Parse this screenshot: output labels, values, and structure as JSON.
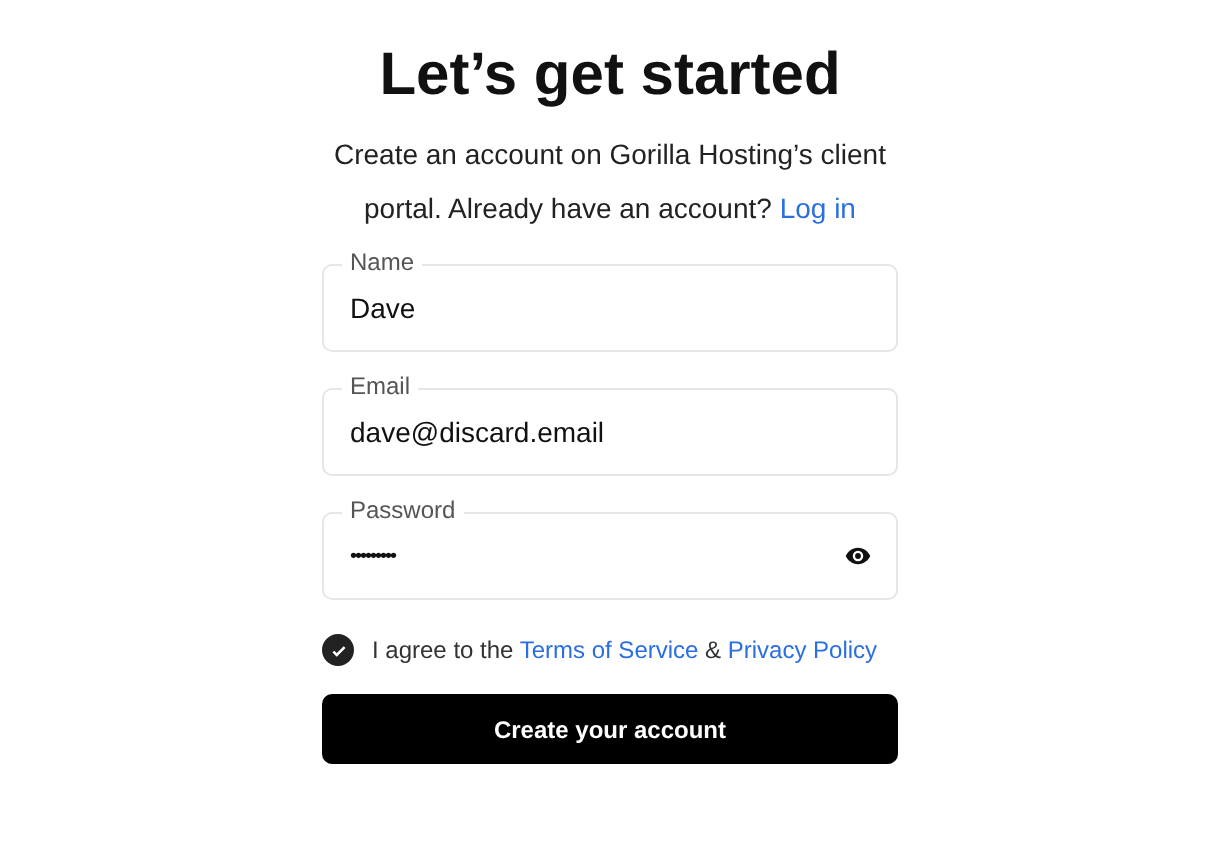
{
  "title": "Let’s get started",
  "subtitle": {
    "text": "Create an account on Gorilla Hosting’s client portal. Already have an account?",
    "link": "Log in"
  },
  "fields": [
    {
      "label": "Name",
      "value": "Dave",
      "kind": "text"
    },
    {
      "label": "Email",
      "value": "dave@discard.email",
      "kind": "text"
    },
    {
      "label": "Password",
      "value": "•••••••••",
      "kind": "password"
    }
  ],
  "agree": {
    "checked": true,
    "prefix": "I agree to the",
    "terms": "Terms of Service",
    "joiner": "&",
    "privacy": "Privacy Policy"
  },
  "submit": "Create your account"
}
